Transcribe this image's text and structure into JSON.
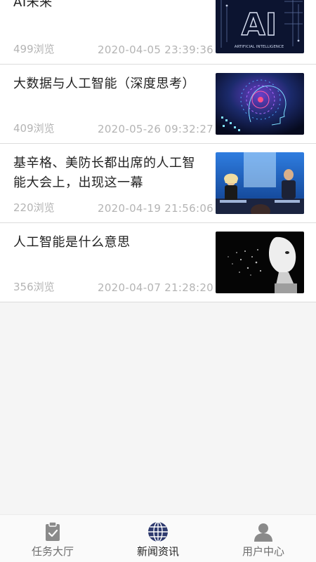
{
  "news": [
    {
      "title": "AI未来",
      "views": "499浏览",
      "time": "2020-04-05 23:39:36",
      "image": "ai-letters-image"
    },
    {
      "title": "大数据与人工智能（深度思考）",
      "views": "409浏览",
      "time": "2020-05-26 09:32:27",
      "image": "robot-head-circuit-image"
    },
    {
      "title": "基辛格、美防长都出席的人工智能大会上，出现这一幕",
      "views": "220浏览",
      "time": "2020-04-19 21:56:06",
      "image": "conference-stage-image"
    },
    {
      "title": "人工智能是什么意思",
      "views": "356浏览",
      "time": "2020-04-07 21:28:20",
      "image": "android-face-image"
    }
  ],
  "thumb_text": {
    "ai_letters": "AI",
    "ai_caption": "ARTIFICIAL INTELLIGENCE"
  },
  "tabs": [
    {
      "label": "任务大厅",
      "icon": "clipboard-icon",
      "active": false
    },
    {
      "label": "新闻资讯",
      "icon": "globe-icon",
      "active": true
    },
    {
      "label": "用户中心",
      "icon": "user-icon",
      "active": false
    }
  ],
  "colors": {
    "active_icon": "#2e3a6e",
    "inactive_icon": "#8a8a8a",
    "meta_text": "#b4b4b4"
  }
}
